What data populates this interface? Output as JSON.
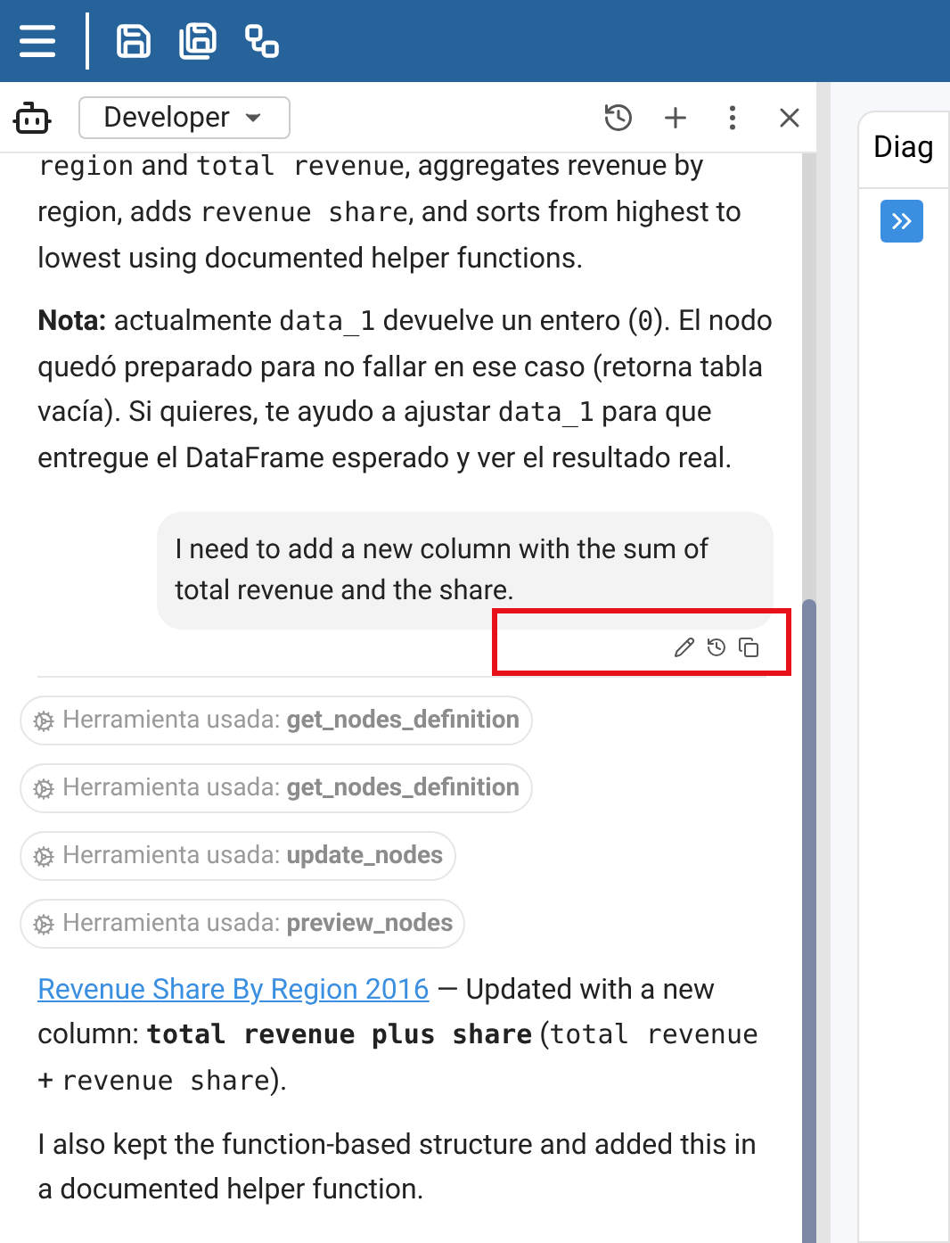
{
  "toolbar": {
    "buttons": [
      {
        "kind": "menu"
      },
      {
        "kind": "save"
      },
      {
        "kind": "save-all"
      },
      {
        "kind": "diagram"
      }
    ]
  },
  "chat_header": {
    "mode": "Developer"
  },
  "messages": [
    {
      "kind": "assistant",
      "paragraphs": [
        [
          {
            "kind": "code",
            "text": "region"
          },
          {
            "kind": "text",
            "text": " and "
          },
          {
            "kind": "code",
            "text": "total revenue"
          },
          {
            "kind": "text",
            "text": ", aggregates revenue by region, adds "
          },
          {
            "kind": "code",
            "text": "revenue share"
          },
          {
            "kind": "text",
            "text": ", and sorts from highest to lowest using documented helper functions."
          }
        ],
        [
          {
            "kind": "bold",
            "text": "Nota:"
          },
          {
            "kind": "text",
            "text": " actualmente "
          },
          {
            "kind": "code",
            "text": "data_1"
          },
          {
            "kind": "text",
            "text": " devuelve un entero ("
          },
          {
            "kind": "code",
            "text": "0"
          },
          {
            "kind": "text",
            "text": "). El nodo quedó preparado para no fallar en ese caso (retorna tabla vacía). Si quieres, te ayudo a ajustar "
          },
          {
            "kind": "code",
            "text": "data_1"
          },
          {
            "kind": "text",
            "text": " para que entregue el DataFrame esperado y ver el resultado real."
          }
        ]
      ]
    },
    {
      "kind": "user",
      "text": "I need to add a new column with the sum of total revenue and the share.",
      "highlighted": true
    },
    {
      "kind": "tool",
      "label": "Herramienta usada:",
      "tool": "get_nodes_definition"
    },
    {
      "kind": "tool",
      "label": "Herramienta usada:",
      "tool": "get_nodes_definition"
    },
    {
      "kind": "tool",
      "label": "Herramienta usada:",
      "tool": "update_nodes"
    },
    {
      "kind": "tool",
      "label": "Herramienta usada:",
      "tool": "preview_nodes"
    },
    {
      "kind": "assistant",
      "paragraphs": [
        [
          {
            "kind": "link",
            "text": "Revenue Share By Region 2016"
          },
          {
            "kind": "text",
            "text": " — Updated with a new column: "
          },
          {
            "kind": "codebold",
            "text": "total revenue plus share"
          },
          {
            "kind": "text",
            "text": " ("
          },
          {
            "kind": "code",
            "text": "total revenue"
          },
          {
            "kind": "text",
            "text": " + "
          },
          {
            "kind": "code",
            "text": "revenue share"
          },
          {
            "kind": "text",
            "text": ")."
          }
        ],
        [
          {
            "kind": "text",
            "text": "I also kept the function-based structure and added this in a documented helper function."
          }
        ]
      ]
    }
  ],
  "side_panel": {
    "title": "Diag"
  }
}
